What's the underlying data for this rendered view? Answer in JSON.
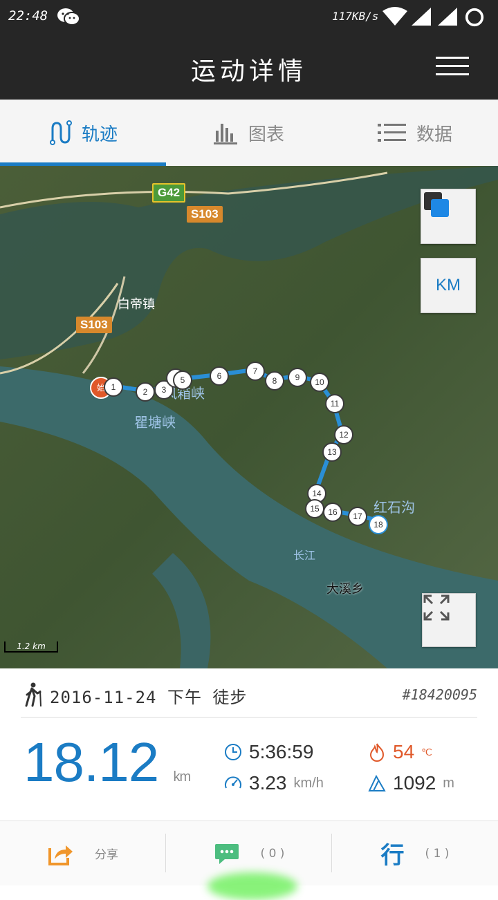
{
  "status_bar": {
    "time": "22:48",
    "net_speed": "117KB/s",
    "icons": [
      "wechat-icon",
      "wifi-icon",
      "signal-icon",
      "signal-icon",
      "battery-ring-icon"
    ]
  },
  "app_bar": {
    "title": "运动详情",
    "menu_icon": "hamburger-menu-icon"
  },
  "tabs": [
    {
      "label": "轨迹",
      "icon": "track-icon",
      "active": true
    },
    {
      "label": "图表",
      "icon": "bar-chart-icon",
      "active": false
    },
    {
      "label": "数据",
      "icon": "list-icon",
      "active": false
    }
  ],
  "map": {
    "road_labels": [
      "G42",
      "S103",
      "S103"
    ],
    "place_labels": [
      "白帝镇",
      "瞿塘峡",
      "风箱峡",
      "红石沟",
      "长江",
      "大溪乡"
    ],
    "start_marker": "始",
    "route_markers": [
      "1",
      "2",
      "3",
      "4",
      "5",
      "6",
      "7",
      "8",
      "9",
      "10",
      "11",
      "12",
      "13",
      "14",
      "15",
      "16",
      "17",
      "18"
    ],
    "layer_button_icon": "map-layer-icon",
    "unit_toggle": "KM",
    "fullscreen_icon": "fullscreen-icon",
    "scale": "1.2 km",
    "route_color": "#2a8fd6"
  },
  "summary": {
    "activity_icon": "hiking-icon",
    "date_text": "2016-11-24 下午 徒步",
    "record_id": "#18420095",
    "distance": "18.12",
    "distance_unit": "km",
    "duration": "5:36:59",
    "speed": "3.23",
    "speed_unit": "km/h",
    "temperature": "54",
    "temperature_unit": "℃",
    "elevation": "1092",
    "elevation_unit": "m",
    "accent_color": "#1b7cc4",
    "temp_color": "#e0592a"
  },
  "bottom_bar": {
    "share_label": "分享",
    "comment_count": "( 0 )",
    "xing_label": "行",
    "xing_count": "( 1 )"
  }
}
